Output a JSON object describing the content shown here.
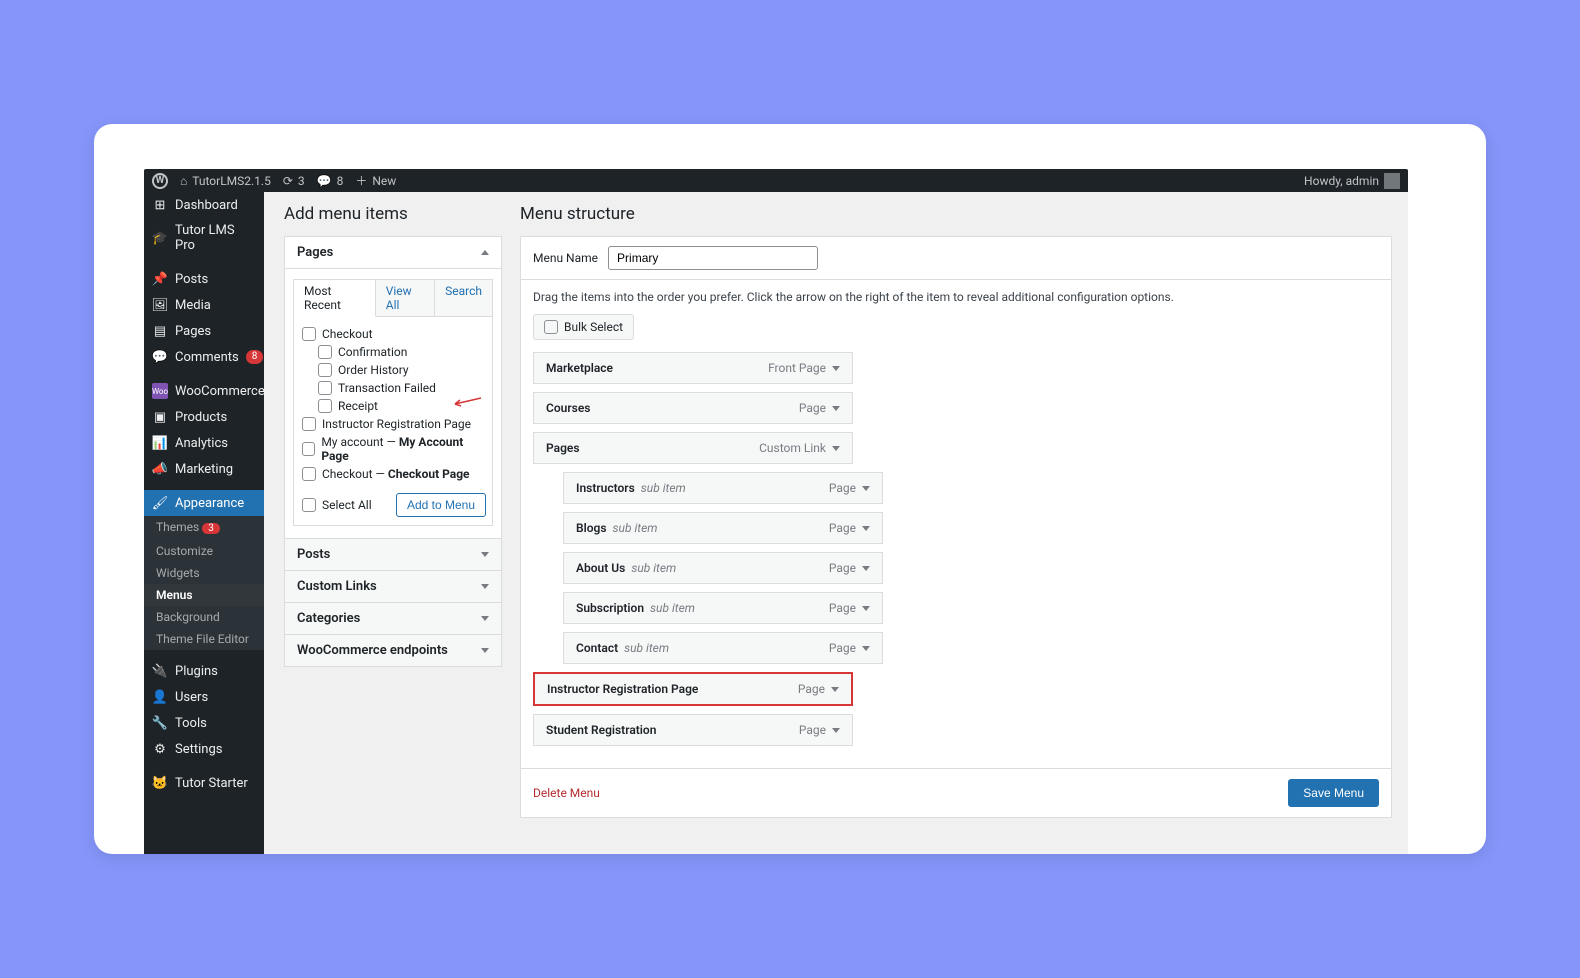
{
  "adminbar": {
    "site_name": "TutorLMS2.1.5",
    "updates_count": "3",
    "comments_count": "8",
    "new_label": "New",
    "howdy": "Howdy, admin"
  },
  "sidebar": {
    "dashboard": "Dashboard",
    "tutor_lms_pro": "Tutor LMS Pro",
    "posts": "Posts",
    "media": "Media",
    "pages": "Pages",
    "comments": "Comments",
    "comments_badge": "8",
    "woocommerce": "WooCommerce",
    "products": "Products",
    "analytics": "Analytics",
    "marketing": "Marketing",
    "appearance": "Appearance",
    "themes": "Themes",
    "themes_badge": "3",
    "customize": "Customize",
    "widgets": "Widgets",
    "menus": "Menus",
    "background": "Background",
    "theme_file_editor": "Theme File Editor",
    "plugins": "Plugins",
    "users": "Users",
    "tools": "Tools",
    "settings": "Settings",
    "tutor_starter": "Tutor Starter"
  },
  "left_col": {
    "heading": "Add menu items",
    "pages": "Pages",
    "posts": "Posts",
    "custom_links": "Custom Links",
    "categories": "Categories",
    "woo_endpoints": "WooCommerce endpoints",
    "tab_recent": "Most Recent",
    "tab_view_all": "View All",
    "tab_search": "Search",
    "items": {
      "checkout": "Checkout",
      "confirmation": "Confirmation",
      "order_history": "Order History",
      "transaction_failed": "Transaction Failed",
      "receipt": "Receipt",
      "instructor_reg": "Instructor Registration Page",
      "my_account_pre": "My account — ",
      "my_account_bold": "My Account Page",
      "checkout2_pre": "Checkout — ",
      "checkout2_bold": "Checkout Page"
    },
    "select_all": "Select All",
    "add_to_menu": "Add to Menu"
  },
  "right_col": {
    "heading": "Menu structure",
    "menu_name_label": "Menu Name",
    "menu_name_value": "Primary",
    "hint": "Drag the items into the order you prefer. Click the arrow on the right of the item to reveal additional configuration options.",
    "bulk_select": "Bulk Select",
    "items": [
      {
        "name": "Marketplace",
        "type": "Front Page",
        "sub": false,
        "hl": false
      },
      {
        "name": "Courses",
        "type": "Page",
        "sub": false,
        "hl": false
      },
      {
        "name": "Pages",
        "type": "Custom Link",
        "sub": false,
        "hl": false
      },
      {
        "name": "Instructors",
        "type": "Page",
        "sub": true,
        "hl": false,
        "subtag": "sub item"
      },
      {
        "name": "Blogs",
        "type": "Page",
        "sub": true,
        "hl": false,
        "subtag": "sub item"
      },
      {
        "name": "About Us",
        "type": "Page",
        "sub": true,
        "hl": false,
        "subtag": "sub item"
      },
      {
        "name": "Subscription",
        "type": "Page",
        "sub": true,
        "hl": false,
        "subtag": "sub item"
      },
      {
        "name": "Contact",
        "type": "Page",
        "sub": true,
        "hl": false,
        "subtag": "sub item"
      },
      {
        "name": "Instructor Registration Page",
        "type": "Page",
        "sub": false,
        "hl": true
      },
      {
        "name": "Student Registration",
        "type": "Page",
        "sub": false,
        "hl": false
      }
    ],
    "delete_menu": "Delete Menu",
    "save_menu": "Save Menu"
  }
}
